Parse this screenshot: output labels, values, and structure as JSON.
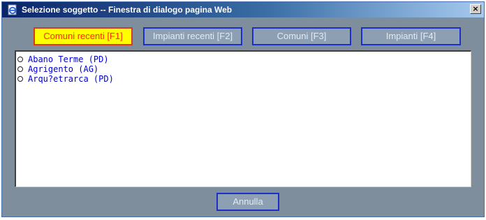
{
  "window": {
    "title": "Selezione soggetto -- Finestra di dialogo pagina Web",
    "close_symbol": "×",
    "icon": "ie-page-icon"
  },
  "tabs": [
    {
      "label": "Comuni recenti [F1]",
      "active": true
    },
    {
      "label": "Impianti recenti [F2]",
      "active": false
    },
    {
      "label": "Comuni [F3]",
      "active": false
    },
    {
      "label": "Impianti [F4]",
      "active": false
    }
  ],
  "list": {
    "items": [
      {
        "label": "Abano Terme (PD)"
      },
      {
        "label": "Agrigento (AG)"
      },
      {
        "label": "Arqu?etrarca (PD)"
      }
    ]
  },
  "footer": {
    "cancel_label": "Annulla"
  },
  "colors": {
    "active_tab_bg": "#ffff00",
    "active_tab_text": "#ff2a00",
    "tab_bg": "#8c9fb3",
    "tab_border": "#1c2fc8",
    "dialog_bg": "#7f8e9c",
    "list_text": "#0000cc"
  }
}
